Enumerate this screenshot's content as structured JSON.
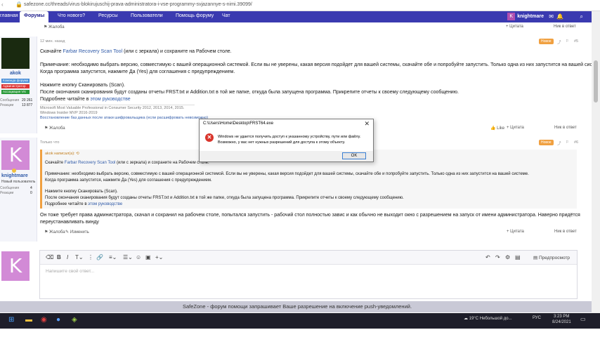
{
  "browser": {
    "url": "safezone.cc/threads/virus-blokirujuschij-prava-administratora-i-vse-programmy-svjazannye-s-nimi.39099/"
  },
  "nav": {
    "items": [
      "главная",
      "Форумы",
      "Что нового?",
      "Ресурсы",
      "Пользователи",
      "Помощь форуму",
      "Чат"
    ],
    "active": "Форумы",
    "username": "knightmare",
    "user_initial": "K"
  },
  "post_top": {
    "complaint": "Жалоба",
    "quote": "+ Цитата",
    "reply": "Ник в ответ"
  },
  "post1": {
    "time": "12 мин. назад",
    "number": "#5",
    "badge": "Новое",
    "author": "akok",
    "roles": [
      "Команда форума",
      "Администратор",
      "Ассоциация VN"
    ],
    "stats": [
      {
        "label": "Сообщения",
        "value": "20 261"
      },
      {
        "label": "Реакции",
        "value": "13 877"
      }
    ],
    "line1_pre": "Скачайте ",
    "line1_link": "Farbar Recovery Scan Tool",
    "line1_post": " (или с зеркала) и сохраните на Рабочем столе.",
    "line2": "Примечание: необходимо выбрать версию, совместимую с вашей операционной системой. Если вы не уверены, какая версия подойдет для вашей системы, скачайте обе и попробуйте запустить. Только одна из них запустится на вашей системе.",
    "line3": "Когда программа запустится, нажмите Да (Yes) для соглашения с предупреждением.",
    "line4": "Нажмите кнопку Сканировать (Scan).",
    "line5": "После окончания сканирования будут созданы отчеты FRST.txt и Addition.txt в той же папке, откуда была запущена программа. Прикрепите отчеты к своему следующему сообщению.",
    "line6_pre": "Подробнее читайте в ",
    "line6_link": "этом руководстве",
    "sig1": "Microsoft Most Valuable Professional in Consumer Security 2012, 2013, 2014, 2015.",
    "sig2": "Windows Insider MVP 2016-2019",
    "sig3": "Восстановление баз данных после атаки шифровальщика (если расшифровать невозможно)",
    "complaint": "Жалоба",
    "like": "Like",
    "quote": "+ Цитата",
    "reply": "Ник в ответ"
  },
  "post2": {
    "time": "Только что",
    "number": "#6",
    "badge": "Новое",
    "author": "knightmare",
    "initial": "K",
    "role": "Новый пользователь",
    "stats": [
      {
        "label": "Сообщения",
        "value": "4"
      },
      {
        "label": "Реакции",
        "value": "0"
      }
    ],
    "quote_author": "akok написал(а):",
    "q1_pre": "Скачайте ",
    "q1_link": "Farbar Recovery Scan Tool",
    "q1_post": " (или с зеркала) и сохраните на Рабочем столе.",
    "q2": "Примечание: необходимо выбрать версию, совместимую с вашей операционной системой. Если вы не уверены, какая версия подойдет для вашей системы, скачайте обе и попробуйте запустить. Только одна из них запустится на вашей системе.",
    "q3": "Когда программа запустится, нажмите Да (Yes) для соглашения с предупреждением.",
    "q4": "Нажмите кнопку Сканировать (Scan).",
    "q5": "После окончания сканирования будут созданы отчеты FRST.txt и Addition.txt в той же папке, откуда была запущена программа. Прикрепите отчеты к своему следующему сообщению.",
    "q6_pre": "Подробнее читайте в ",
    "q6_link": "этом руководстве",
    "text1": "Он тоже требует права администратора, скачал и сохранил на рабочем столе, попытался запустить - рабочий стол полностью завис и как обычно не выходит окно с разрешением на запуск от имени администратора. Наверно придётся",
    "text2": "переустанавливать винду",
    "complaint": "Жалоба",
    "edit": "Изменить",
    "quote": "+ Цитата",
    "reply": "Ник в ответ"
  },
  "editor": {
    "initial": "K",
    "placeholder": "Напишите свой ответ...",
    "preview": "Предпросмотр"
  },
  "dialog": {
    "title": "C:\\Users\\Home\\Desktop\\FRST64.exe",
    "line1": "Windows не удается получить доступ к указанному устройству, пути или файлу.",
    "line2": "Возможно, у вас нет нужных разрешений для доступа к этому объекту.",
    "ok": "OK"
  },
  "push_banner": "SafeZone - форум помощи запрашивает Ваше разрешение на включение push-уведомлений.",
  "taskbar": {
    "weather": "19°C  Небольшой до...",
    "lang": "РУС",
    "time": "3:23 PM",
    "date": "8/24/2021"
  },
  "colors": {
    "nav": "#3a3ab0",
    "accent": "#f0a040",
    "avatar": "#d28ad6"
  }
}
